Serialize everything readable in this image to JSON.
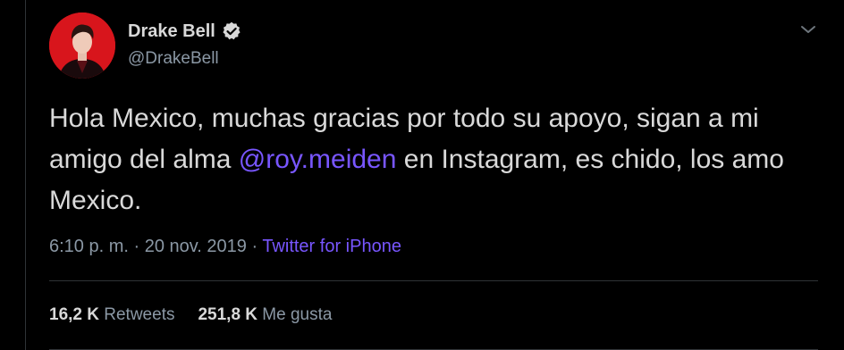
{
  "tweet": {
    "author": {
      "display_name": "Drake Bell",
      "handle": "@DrakeBell",
      "verified_icon": "verified-badge-icon",
      "avatar_bg": "#d8151c"
    },
    "text_before_mention": "Hola Mexico, muchas gracias por todo su apoyo, sigan a mi amigo del alma ",
    "mention": "@roy.meiden",
    "text_after_mention": " en Instagram, es chido, los amo Mexico.",
    "time": "6:10 p. m.",
    "separator": " · ",
    "date": "20 nov. 2019",
    "source": "Twitter for iPhone",
    "stats": {
      "retweets_count": "16,2 K",
      "retweets_label": "Retweets",
      "likes_count": "251,8 K",
      "likes_label": "Me gusta"
    },
    "menu_icon": "chevron-down-icon"
  },
  "colors": {
    "background": "#000000",
    "text": "#d9d9d9",
    "secondary": "#8b98a5",
    "accent": "#7856ff"
  }
}
